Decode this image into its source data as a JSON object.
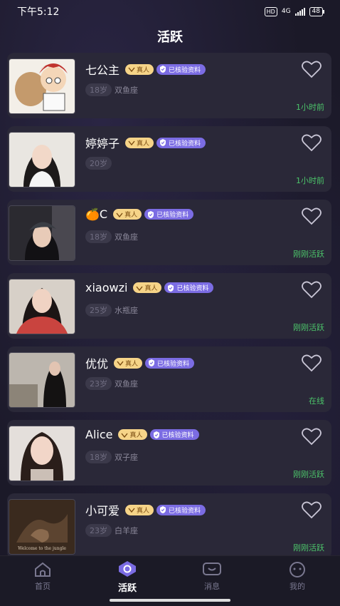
{
  "status_bar": {
    "time": "下午5:12",
    "hd": "HD",
    "network": "4G",
    "battery": "48"
  },
  "page": {
    "title": "活跃"
  },
  "profiles": [
    {
      "name": "七公主",
      "age": "18岁",
      "zodiac": "双鱼座",
      "real_tag": "真人",
      "verified_tag": "已核验资料",
      "active": "1小时前",
      "avatar": "cartoon-character"
    },
    {
      "name": "婷婷子",
      "age": "20岁",
      "zodiac": "",
      "real_tag": "真人",
      "verified_tag": "已核验资料",
      "active": "1小时前",
      "avatar": "girl-white-shirt"
    },
    {
      "name": "🍊C",
      "age": "18岁",
      "zodiac": "双鱼座",
      "real_tag": "真人",
      "verified_tag": "已核验资料",
      "active": "刚刚活跃",
      "avatar": "girl-cap"
    },
    {
      "name": "xiaowzi",
      "age": "25岁",
      "zodiac": "水瓶座",
      "real_tag": "真人",
      "verified_tag": "已核验资料",
      "active": "刚刚活跃",
      "avatar": "girl-red-top"
    },
    {
      "name": "优优",
      "age": "23岁",
      "zodiac": "双鱼座",
      "real_tag": "真人",
      "verified_tag": "已核验资料",
      "active": "在线",
      "avatar": "girl-kitchen"
    },
    {
      "name": "Alice",
      "age": "18岁",
      "zodiac": "双子座",
      "real_tag": "真人",
      "verified_tag": "已核验资料",
      "active": "刚刚活跃",
      "avatar": "girl-long-hair"
    },
    {
      "name": "小可爱",
      "age": "23岁",
      "zodiac": "白羊座",
      "real_tag": "真人",
      "verified_tag": "已核验资料",
      "active": "刚刚活跃",
      "avatar": "dark-photo"
    }
  ],
  "avatar_caption": "Welcome to the jungle",
  "nav": {
    "home": "首页",
    "active": "活跃",
    "messages": "消息",
    "me": "我的"
  },
  "colors": {
    "background": "#1b1928",
    "card": "#2a2838",
    "online_green": "#4cc46a",
    "real_tag": "#f6d488",
    "verified_tag": "#7b6ce3"
  }
}
